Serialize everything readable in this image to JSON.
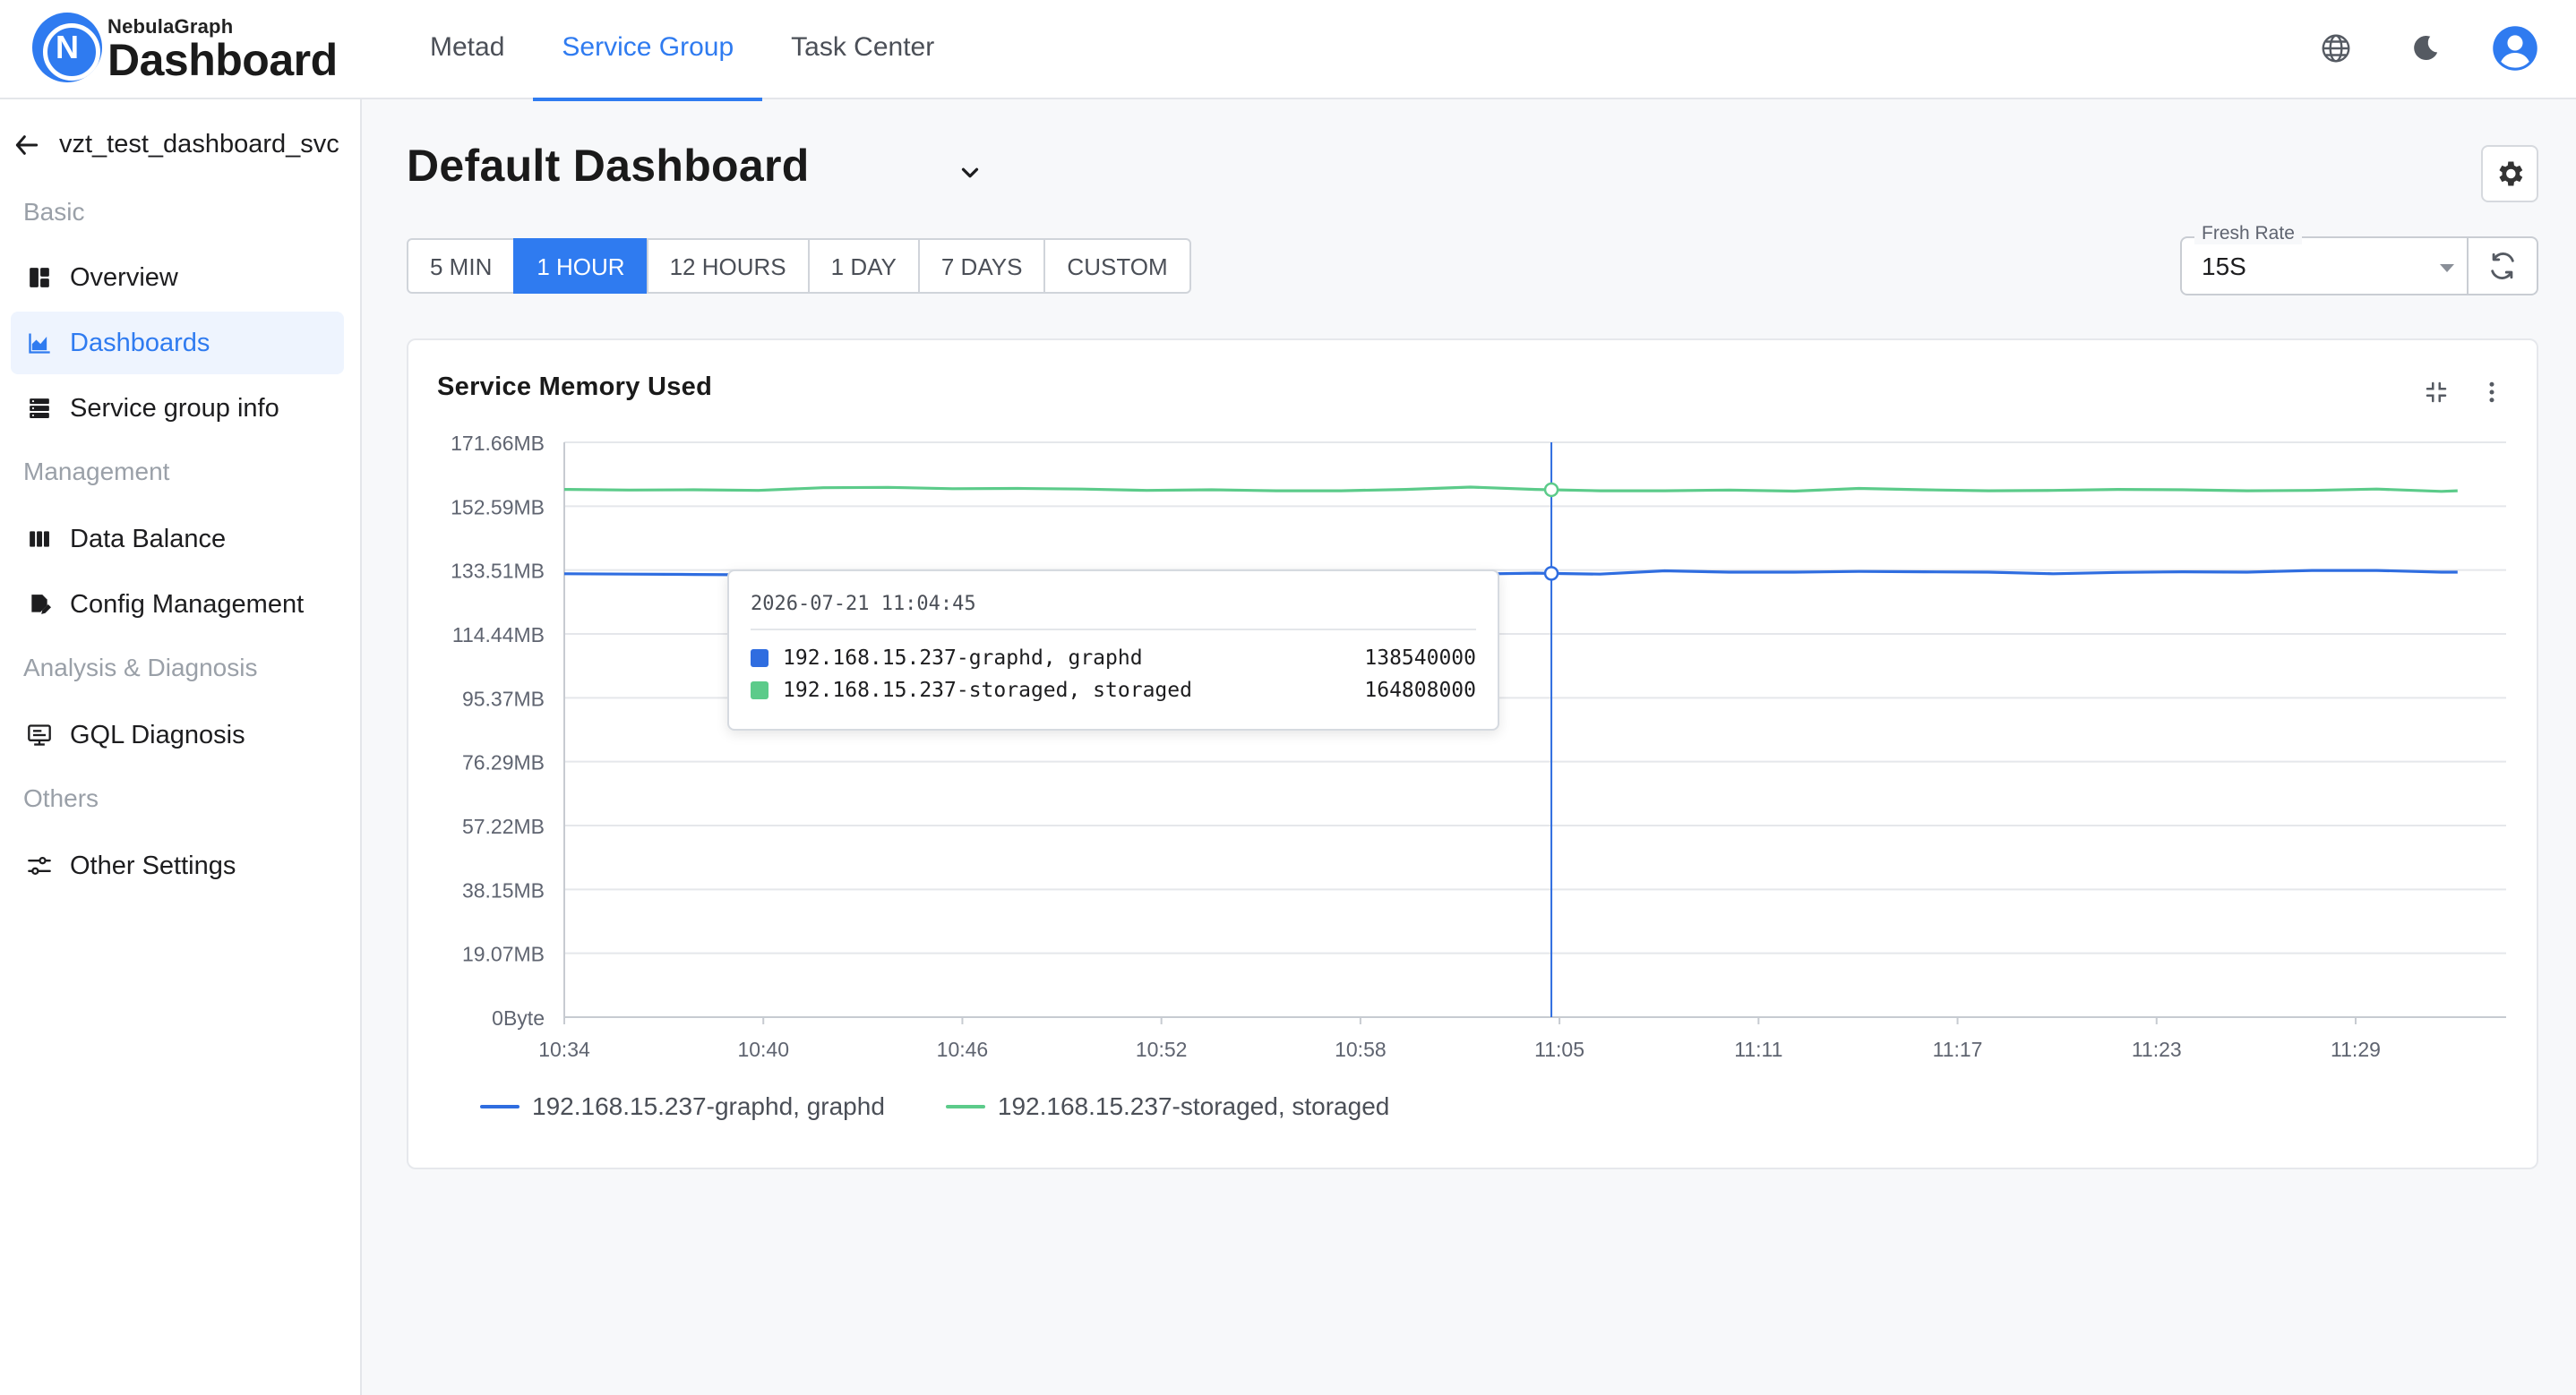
{
  "app": {
    "brand_small": "NebulaGraph",
    "brand_big": "Dashboard",
    "brand_letter": "N"
  },
  "top_nav": [
    {
      "label": "Metad",
      "active": false
    },
    {
      "label": "Service Group",
      "active": true
    },
    {
      "label": "Task Center",
      "active": false
    }
  ],
  "header_icons": [
    "globe-icon",
    "moon-icon",
    "user-avatar-icon"
  ],
  "sidebar": {
    "back_label": "vzt_test_dashboard_svc",
    "sections": [
      {
        "title": "Basic",
        "items": [
          {
            "label": "Overview",
            "icon": "overview-icon",
            "active": false
          },
          {
            "label": "Dashboards",
            "icon": "area-chart-icon",
            "active": true
          },
          {
            "label": "Service group info",
            "icon": "server-icon",
            "active": false
          }
        ]
      },
      {
        "title": "Management",
        "items": [
          {
            "label": "Data Balance",
            "icon": "columns-icon",
            "active": false
          },
          {
            "label": "Config Management",
            "icon": "edit-file-icon",
            "active": false
          }
        ]
      },
      {
        "title": "Analysis & Diagnosis",
        "items": [
          {
            "label": "GQL Diagnosis",
            "icon": "monitor-icon",
            "active": false
          }
        ]
      },
      {
        "title": "Others",
        "items": [
          {
            "label": "Other Settings",
            "icon": "sliders-icon",
            "active": false
          }
        ]
      }
    ]
  },
  "main": {
    "title": "Default Dashboard",
    "time_ranges": [
      {
        "label": "5 MIN",
        "active": false
      },
      {
        "label": "1 HOUR",
        "active": true
      },
      {
        "label": "12 HOURS",
        "active": false
      },
      {
        "label": "1 DAY",
        "active": false
      },
      {
        "label": "7 DAYS",
        "active": false
      },
      {
        "label": "CUSTOM",
        "active": false
      }
    ],
    "fresh_rate": {
      "label": "Fresh Rate",
      "value": "15S"
    }
  },
  "card": {
    "title": "Service Memory Used"
  },
  "tooltip": {
    "time": "2026-07-21 11:04:45",
    "rows": [
      {
        "name": "192.168.15.237-graphd, graphd",
        "value": "138540000",
        "color": "#2f6de0"
      },
      {
        "name": "192.168.15.237-storaged, storaged",
        "value": "164808000",
        "color": "#5ccb8a"
      }
    ]
  },
  "chart_data": {
    "type": "line",
    "title": "Service Memory Used",
    "xlabel": "",
    "ylabel": "",
    "x_ticks": [
      "10:34",
      "10:40",
      "10:46",
      "10:52",
      "10:58",
      "11:05",
      "11:11",
      "11:17",
      "11:23",
      "11:29"
    ],
    "y_ticks": [
      "0Byte",
      "19.07MB",
      "38.15MB",
      "57.22MB",
      "76.29MB",
      "95.37MB",
      "114.44MB",
      "133.51MB",
      "152.59MB",
      "171.66MB"
    ],
    "ylim_mb": [
      0,
      171.66
    ],
    "xlim_min": [
      0,
      60
    ],
    "grid": true,
    "legend_position": "bottom-left",
    "cursor_x_min": 30.5,
    "series": [
      {
        "name": "192.168.15.237-graphd, graphd",
        "color": "#2f6de0",
        "x_min": [
          0,
          2,
          4,
          6,
          8,
          10,
          12,
          14,
          16,
          18,
          20,
          22,
          24,
          26,
          28,
          30,
          32,
          34,
          36,
          38,
          40,
          42,
          44,
          46,
          48,
          50,
          52,
          54,
          56,
          58,
          58.5
        ],
        "y_mb": [
          132.4,
          132.3,
          132.2,
          132.1,
          132.4,
          132.9,
          132.8,
          132.2,
          132.3,
          132.3,
          132.4,
          132.3,
          132.3,
          132.4,
          132.3,
          132.6,
          132.3,
          133.3,
          132.9,
          132.9,
          133.1,
          133.0,
          132.9,
          132.4,
          132.8,
          133.0,
          132.9,
          133.4,
          133.4,
          132.9,
          132.9
        ]
      },
      {
        "name": "192.168.15.237-storaged, storaged",
        "color": "#5ccb8a",
        "x_min": [
          0,
          2,
          4,
          6,
          8,
          10,
          12,
          14,
          16,
          18,
          20,
          22,
          24,
          26,
          28,
          30,
          32,
          34,
          36,
          38,
          40,
          42,
          44,
          46,
          48,
          50,
          52,
          54,
          56,
          58,
          58.5
        ],
        "y_mb": [
          157.6,
          157.4,
          157.5,
          157.3,
          158.1,
          158.2,
          157.8,
          157.9,
          157.7,
          157.3,
          157.5,
          157.2,
          157.2,
          157.6,
          158.3,
          157.6,
          157.2,
          157.2,
          157.4,
          157.1,
          157.9,
          157.5,
          157.2,
          157.3,
          157.6,
          157.5,
          157.2,
          157.3,
          157.7,
          157.0,
          157.2
        ]
      }
    ]
  }
}
